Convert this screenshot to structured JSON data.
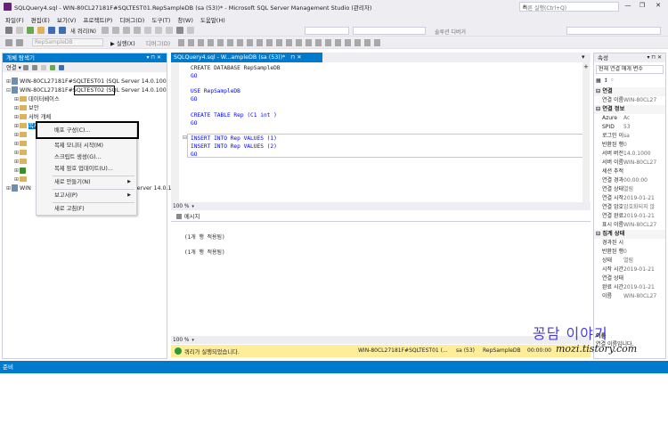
{
  "window": {
    "title": "SQLQuery4.sql - WIN-80CL27181F#SQLTEST01.RepSampleDB (sa (53))* - Microsoft SQL Server Management Studio (관리자)",
    "quick_launch_placeholder": "빠른 실행(Ctrl+Q)"
  },
  "menu": [
    "파일(F)",
    "편집(E)",
    "보기(V)",
    "프로젝트(P)",
    "디버그(D)",
    "도구(T)",
    "창(W)",
    "도움말(H)"
  ],
  "toolbar": {
    "new_query_label": "새 쿼리(N)",
    "execute_label": "실행(X)",
    "debug_label": "디버그(D)",
    "db_combo_value": "RepSampleDB",
    "solution_config": "솔루션 디버거"
  },
  "object_explorer": {
    "title": "개체 탐색기",
    "connect_label": "연결 ▾",
    "servers": [
      {
        "label": "WIN-80CL27181F#SQLTEST01 (SQL Server 14.0.100"
      },
      {
        "label": "WIN-80CL27181F#SQLTEST02 (SQL Server 14.0.100"
      }
    ],
    "folders": [
      "데이터베이스",
      "보안",
      "서버 개체",
      "복제"
    ],
    "third_server": "WIN",
    "third_server_suffix": "Server 14.0.100"
  },
  "context_menu": {
    "items": [
      "배포 구성(C)...",
      "복제 모니터 시작(M)",
      "스크립트 생성(G)...",
      "복제 암호 업데이트(U)...",
      "새로 만들기(N)",
      "보고서(P)",
      "새로 고침(F)"
    ]
  },
  "editor": {
    "tab_label": "SQLQuery4.sql - W...ampleDB (sa (53))*",
    "code": {
      "l1": "CREATE DATABASE RepSampleDB",
      "l2": "GO",
      "l3": "USE RepSampleDB",
      "l4": "GO",
      "l5": "CREATE TABLE Rep (C1 int )",
      "l6": "GO",
      "l7": "INSERT INTO Rep VALUES (1)",
      "l8": "INSERT INTO Rep VALUES (2)",
      "l9": "GO"
    },
    "zoom": "100 %",
    "messages_tab": "메시지",
    "messages": [
      "(1개 행 적용됨)",
      "(1개 행 적용됨)"
    ],
    "status_text": "쿼리가 실행되었습니다.",
    "status_server": "WIN-80CL27181F#SQLTEST01 (...",
    "status_user": "sa (53)",
    "status_db": "RepSampleDB",
    "status_time": "00:00:00"
  },
  "properties": {
    "title": "속성",
    "combo": "현재 연결 매개 변수",
    "categories": {
      "c1": "연결",
      "c2": "연결 정보",
      "c3": "집계 상태"
    },
    "rows": [
      {
        "k": "연결 이름",
        "v": "WIN-80CL27"
      },
      {
        "k": "Azure",
        "v": "Ac"
      },
      {
        "k": "SPID",
        "v": "53"
      },
      {
        "k": "로그인 이",
        "v": "sa"
      },
      {
        "k": "반환된 행",
        "v": "0"
      },
      {
        "k": "서버 버전",
        "v": "14.0.1000"
      },
      {
        "k": "서버 이름",
        "v": "WIN-80CL27"
      },
      {
        "k": "세션 추적",
        "v": ""
      },
      {
        "k": "연결 경과",
        "v": "00:00:00"
      },
      {
        "k": "연결 상태",
        "v": "열림"
      },
      {
        "k": "연결 시작",
        "v": "2019-01-21"
      },
      {
        "k": "연결 암호",
        "v": "암호화되지 않"
      },
      {
        "k": "연결 완료",
        "v": "2019-01-21"
      },
      {
        "k": "표시 이름",
        "v": "WIN-80CL27"
      }
    ],
    "rows2": [
      {
        "k": "경과된 시",
        "v": ""
      },
      {
        "k": "반환된 행",
        "v": "0"
      },
      {
        "k": "상태",
        "v": "열림"
      },
      {
        "k": "시작 시간",
        "v": "2019-01-21"
      },
      {
        "k": "연결 상태",
        "v": ""
      },
      {
        "k": "완료 시간",
        "v": "2019-01-21"
      },
      {
        "k": "이름",
        "v": "WIN-80CL27"
      }
    ],
    "desc_title": "이름",
    "desc_text": "연결 이름입니다."
  },
  "statusbar": {
    "text": "준비"
  },
  "watermark": {
    "l1": "꽁담 이야기",
    "l2": "mozi.tistory.com"
  },
  "colors": {
    "accent": "#007acc",
    "chrome": "#eeeef2",
    "keyword": "#0000ff",
    "status_yellow": "#ffee99"
  }
}
